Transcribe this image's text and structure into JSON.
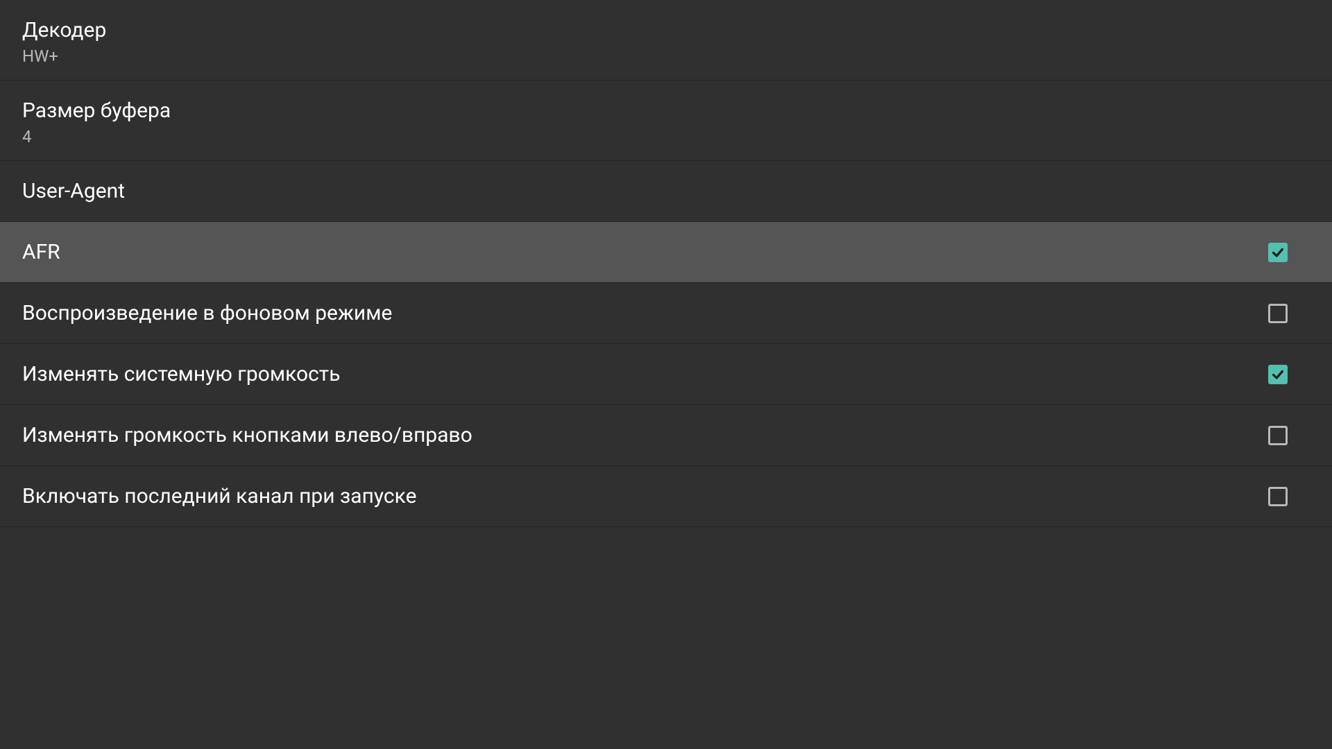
{
  "settings": [
    {
      "key": "decoder",
      "title": "Декодер",
      "value": "HW+",
      "type": "value",
      "active": false
    },
    {
      "key": "buffer-size",
      "title": "Размер буфера",
      "value": "4",
      "type": "value",
      "active": false
    },
    {
      "key": "user-agent",
      "title": "User-Agent",
      "type": "plain",
      "active": false
    },
    {
      "key": "afr",
      "title": "AFR",
      "type": "checkbox",
      "checked": true,
      "active": true
    },
    {
      "key": "background-playback",
      "title": "Воспроизведение в фоновом режиме",
      "type": "checkbox",
      "checked": false,
      "active": false
    },
    {
      "key": "system-volume",
      "title": "Изменять системную громкость",
      "type": "checkbox",
      "checked": true,
      "active": false
    },
    {
      "key": "volume-lr-buttons",
      "title": "Изменять громкость кнопками влево/вправо",
      "type": "checkbox",
      "checked": false,
      "active": false
    },
    {
      "key": "last-channel-on-start",
      "title": "Включать последний канал при запуске",
      "type": "checkbox",
      "checked": false,
      "active": false
    }
  ]
}
